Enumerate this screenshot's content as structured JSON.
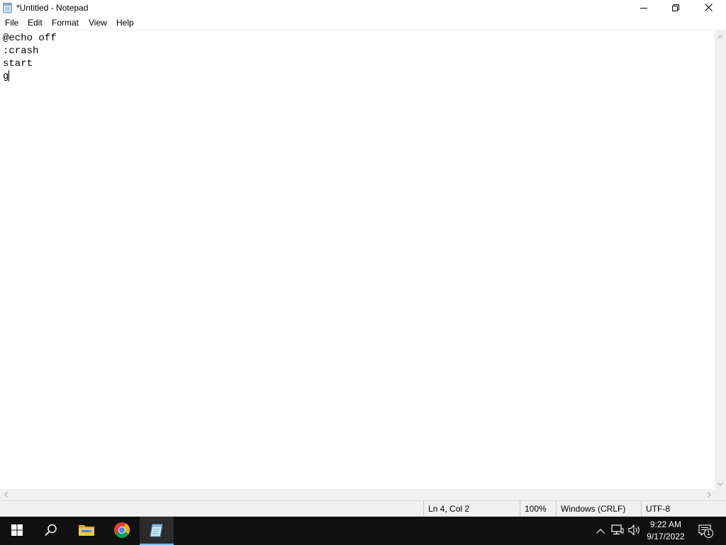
{
  "window": {
    "title": "*Untitled - Notepad",
    "icon": "notepad-icon",
    "controls": {
      "minimize": "minimize-icon",
      "maximize": "restore-icon",
      "close": "close-icon"
    }
  },
  "menu": {
    "items": [
      "File",
      "Edit",
      "Format",
      "View",
      "Help"
    ]
  },
  "editor": {
    "content": "@echo off\n:crash\nstart\ng"
  },
  "statusbar": {
    "position": "Ln 4, Col 2",
    "zoom": "100%",
    "line_ending": "Windows (CRLF)",
    "encoding": "UTF-8"
  },
  "taskbar": {
    "apps": [
      "windows-start-icon",
      "search-icon",
      "file-explorer-icon",
      "chrome-icon",
      "notepad-icon"
    ],
    "active_app": "notepad",
    "tray": [
      "chevron-up-icon",
      "network-icon",
      "volume-icon"
    ],
    "time": "9:22 AM",
    "date": "9/17/2022",
    "notification_count": "1",
    "accent_color": "#76b9ed"
  }
}
